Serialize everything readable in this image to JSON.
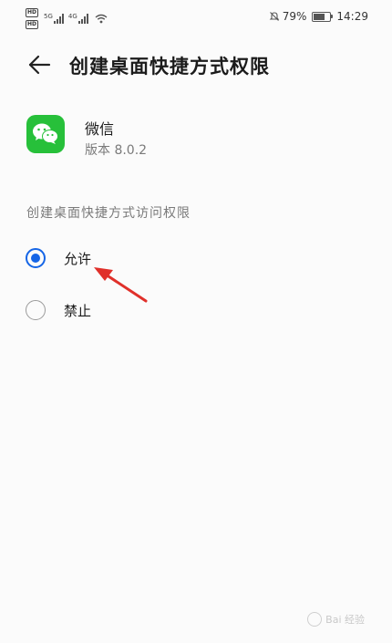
{
  "status_bar": {
    "hd_badge_1": "HD",
    "hd_badge_2": "HD",
    "net_1": "5G",
    "net_2": "4G",
    "battery_percent": "79%",
    "battery_level": 0.79,
    "time": "14:29",
    "icons": [
      "hd-icon",
      "signal-icon",
      "wifi-icon",
      "mute-icon",
      "battery-icon"
    ]
  },
  "header": {
    "title": "创建桌面快捷方式权限",
    "back_icon": "back-arrow-icon"
  },
  "app": {
    "name": "微信",
    "version": "版本 8.0.2",
    "icon": "wechat-icon",
    "icon_color": "#27C03A"
  },
  "permission": {
    "section_label": "创建桌面快捷方式访问权限",
    "options": [
      {
        "label": "允许",
        "selected": true
      },
      {
        "label": "禁止",
        "selected": false
      }
    ],
    "accent_color": "#1565E6"
  },
  "annotation": {
    "arrow_color": "#E0302A"
  },
  "watermark": {
    "text": "Bai 经验"
  }
}
